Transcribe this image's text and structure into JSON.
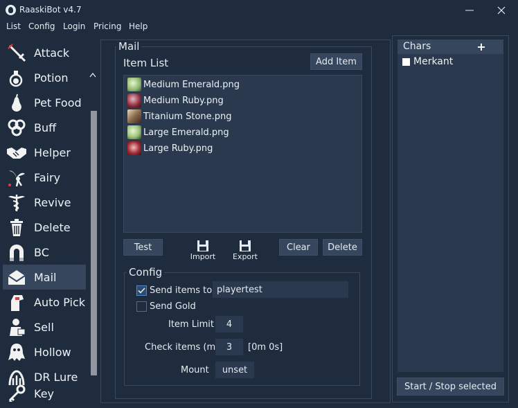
{
  "window": {
    "title": "RaaskiBot v4.7",
    "minimize_symbol": "—",
    "close_symbol": "✕"
  },
  "menu": [
    "List",
    "Config",
    "Login",
    "Pricing",
    "Help"
  ],
  "sidebar": {
    "items": [
      {
        "label": "Attack",
        "icon": "sword-icon"
      },
      {
        "label": "Potion",
        "icon": "potion-icon"
      },
      {
        "label": "Pet Food",
        "icon": "pear-icon"
      },
      {
        "label": "Buff",
        "icon": "triskelion-icon"
      },
      {
        "label": "Helper",
        "icon": "handshake-icon"
      },
      {
        "label": "Fairy",
        "icon": "fairy-icon"
      },
      {
        "label": "Revive",
        "icon": "caduceus-icon"
      },
      {
        "label": "Delete",
        "icon": "trash-icon"
      },
      {
        "label": "BC",
        "icon": "magnet-icon"
      },
      {
        "label": "Mail",
        "icon": "envelope-icon"
      },
      {
        "label": "Auto Pick",
        "icon": "glove-icon"
      },
      {
        "label": "Sell",
        "icon": "merchant-icon"
      },
      {
        "label": "Hollow",
        "icon": "ghost-icon"
      },
      {
        "label": "DR Lure",
        "icon": "lure-icon"
      },
      {
        "label": "Key",
        "icon": "key-icon"
      }
    ],
    "active": "Mail",
    "scroll_up": "^",
    "scroll_down": "v"
  },
  "mail": {
    "group_title": "Mail",
    "item_list_label": "Item List",
    "add_item_label": "Add Item",
    "items": [
      {
        "label": "Medium Emerald.png",
        "color": "#a9c98a"
      },
      {
        "label": "Medium Ruby.png",
        "color": "#8a2a3a"
      },
      {
        "label": "Titanium Stone.png",
        "color": "#b59a7a"
      },
      {
        "label": "Large Emerald.png",
        "color": "#9bc27c"
      },
      {
        "label": "Large Ruby.png",
        "color": "#a02a36"
      }
    ],
    "test_label": "Test",
    "import_label": "Import",
    "export_label": "Export",
    "clear_label": "Clear",
    "delete_label": "Delete"
  },
  "config": {
    "title": "Config",
    "send_items_label": "Send items to",
    "send_items_checked": true,
    "send_items_value": "playertest",
    "send_gold_label": "Send Gold",
    "send_gold_checked": false,
    "item_limit_label": "Item Limit",
    "item_limit_value": "4",
    "check_items_label": "Check items (m)",
    "check_items_value": "3",
    "check_items_timer": "[0m 0s]",
    "mount_label": "Mount",
    "mount_value": "unset"
  },
  "chars": {
    "title": "Chars",
    "add_symbol": "+",
    "list": [
      {
        "name": "Merkant",
        "checked": false
      }
    ],
    "start_stop_label": "Start / Stop selected"
  }
}
